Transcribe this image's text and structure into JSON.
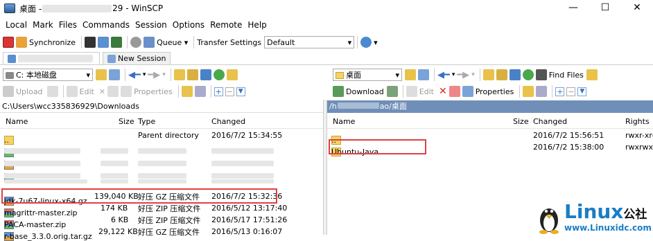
{
  "window": {
    "title_prefix": "桌面 - ",
    "title_suffix": "29 - WinSCP",
    "min": "—",
    "max": "☐",
    "close": "✕"
  },
  "menu": [
    "Local",
    "Mark",
    "Files",
    "Commands",
    "Session",
    "Options",
    "Remote",
    "Help"
  ],
  "toolbar1": {
    "synchronize": "Synchronize",
    "queue": "Queue",
    "transfer_label": "Transfer Settings",
    "transfer_value": "Default"
  },
  "tabs": {
    "new_session": "New Session"
  },
  "left": {
    "drive": "C: 本地磁盘",
    "actions": {
      "upload": "Upload",
      "edit": "Edit",
      "properties": "Properties"
    },
    "path": "C:\\Users\\wcc335836929\\Downloads",
    "headers": {
      "name": "Name",
      "size": "Size",
      "type": "Type",
      "changed": "Changed"
    },
    "rows": [
      {
        "name": "..",
        "size": "",
        "type": "Parent directory",
        "changed": "2016/7/2  15:34:55",
        "icon": "up"
      },
      {
        "name": "jdk-7u67-linux-x64.gz",
        "size": "139,040 KB",
        "type": "好压 GZ 压缩文件",
        "changed": "2016/7/2  15:32:36",
        "icon": "gz"
      },
      {
        "name": "magrittr-master.zip",
        "size": "174 KB",
        "type": "好压 ZIP 压缩文件",
        "changed": "2016/5/12  13:17:40",
        "icon": "zip"
      },
      {
        "name": "PACA-master.zip",
        "size": "6 KB",
        "type": "好压 ZIP 压缩文件",
        "changed": "2016/5/17  17:51:26",
        "icon": "zip"
      },
      {
        "name": "r-base_3.3.0.orig.tar.gz",
        "size": "29,122 KB",
        "type": "好压 GZ 压缩文件",
        "changed": "2016/5/13  0:16:07",
        "icon": "gz"
      }
    ]
  },
  "right": {
    "folder": "桌面",
    "actions": {
      "download": "Download",
      "edit": "Edit",
      "properties": "Properties"
    },
    "find_files": "Find Files",
    "path_prefix": "/h",
    "path_mid": "ao/桌面",
    "headers": {
      "name": "Name",
      "size": "Size",
      "changed": "Changed",
      "rights": "Rights"
    },
    "rows": [
      {
        "name": "..",
        "changed": "2016/7/2  15:56:51",
        "rights": "rwxr-xr-x",
        "icon": "up"
      },
      {
        "name": "Ubuntu-Java",
        "changed": "2016/7/2  15:38:00",
        "rights": "rwxrwxr-x",
        "icon": "folder"
      }
    ]
  },
  "watermark": {
    "brand": "Linux",
    "suffix": "公社",
    "url": "www.Linuxidc.com"
  },
  "colors": {
    "highlight": "#e04040",
    "path_bar": "#6f8fb8",
    "selection": "#cce8ff"
  }
}
